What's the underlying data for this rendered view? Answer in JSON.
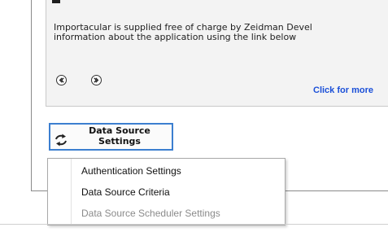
{
  "info": {
    "line1": "Importacular is supplied free of charge by Zeidman Devel",
    "line2": "information about the application using the link below"
  },
  "nav": {
    "prev_icon": "chevron-left-circle-icon",
    "next_icon": "chevron-right-circle-icon"
  },
  "link": {
    "click_more": "Click for more"
  },
  "data_source_button": {
    "line1": "Data Source",
    "line2": "Settings",
    "icon": "refresh-icon"
  },
  "menu": {
    "items": [
      {
        "label": "Authentication Settings",
        "enabled": true
      },
      {
        "label": "Data Source Criteria",
        "enabled": true
      },
      {
        "label": "Data Source Scheduler Settings",
        "enabled": false
      }
    ]
  },
  "colors": {
    "link": "#1a4fd8",
    "button_border": "#3c7fd0",
    "disabled_text": "#8b8b8b"
  }
}
